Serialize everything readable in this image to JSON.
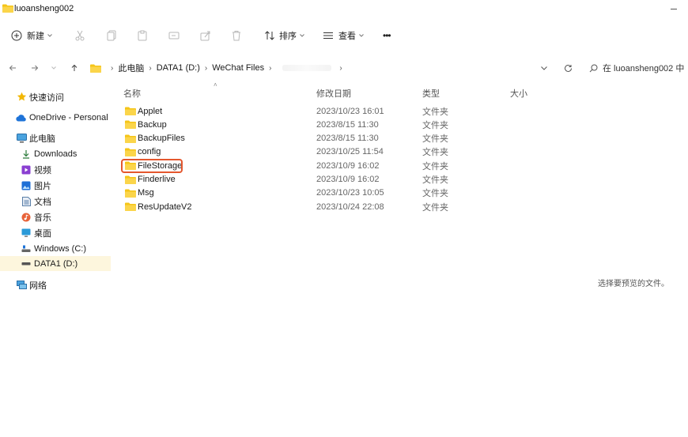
{
  "window": {
    "title": "luoansheng002"
  },
  "toolbar": {
    "new_label": "新建",
    "sort_label": "排序",
    "view_label": "查看",
    "more_label": "•••"
  },
  "address": {
    "crumbs": [
      "此电脑",
      "DATA1 (D:)",
      "WeChat Files"
    ],
    "search_placeholder": "在 luoansheng002 中"
  },
  "sidebar": {
    "items": [
      {
        "label": "快速访问",
        "icon": "star-icon"
      },
      {
        "label": "OneDrive - Personal",
        "icon": "cloud-icon"
      },
      {
        "label": "此电脑",
        "icon": "computer-icon"
      },
      {
        "label": "Downloads",
        "icon": "download-icon"
      },
      {
        "label": "视频",
        "icon": "video-icon"
      },
      {
        "label": "图片",
        "icon": "picture-icon"
      },
      {
        "label": "文档",
        "icon": "document-icon"
      },
      {
        "label": "音乐",
        "icon": "music-icon"
      },
      {
        "label": "桌面",
        "icon": "desktop-icon"
      },
      {
        "label": "Windows (C:)",
        "icon": "drive-icon"
      },
      {
        "label": "DATA1 (D:)",
        "icon": "drive-icon"
      },
      {
        "label": "网络",
        "icon": "network-icon"
      }
    ]
  },
  "columns": {
    "name": "名称",
    "date": "修改日期",
    "type": "类型",
    "size": "大小"
  },
  "files": [
    {
      "name": "Applet",
      "date": "2023/10/23 16:01",
      "type": "文件夹"
    },
    {
      "name": "Backup",
      "date": "2023/8/15 11:30",
      "type": "文件夹"
    },
    {
      "name": "BackupFiles",
      "date": "2023/8/15 11:30",
      "type": "文件夹"
    },
    {
      "name": "config",
      "date": "2023/10/25 11:54",
      "type": "文件夹"
    },
    {
      "name": "FileStorage",
      "date": "2023/10/9 16:02",
      "type": "文件夹"
    },
    {
      "name": "Finderlive",
      "date": "2023/10/9 16:02",
      "type": "文件夹"
    },
    {
      "name": "Msg",
      "date": "2023/10/23 10:05",
      "type": "文件夹"
    },
    {
      "name": "ResUpdateV2",
      "date": "2023/10/24 22:08",
      "type": "文件夹"
    }
  ],
  "preview": {
    "message": "选择要预览的文件。"
  },
  "colors": {
    "folder": "#f5c518",
    "selected_bg": "#fdf6dd",
    "highlight": "#e4572e"
  }
}
